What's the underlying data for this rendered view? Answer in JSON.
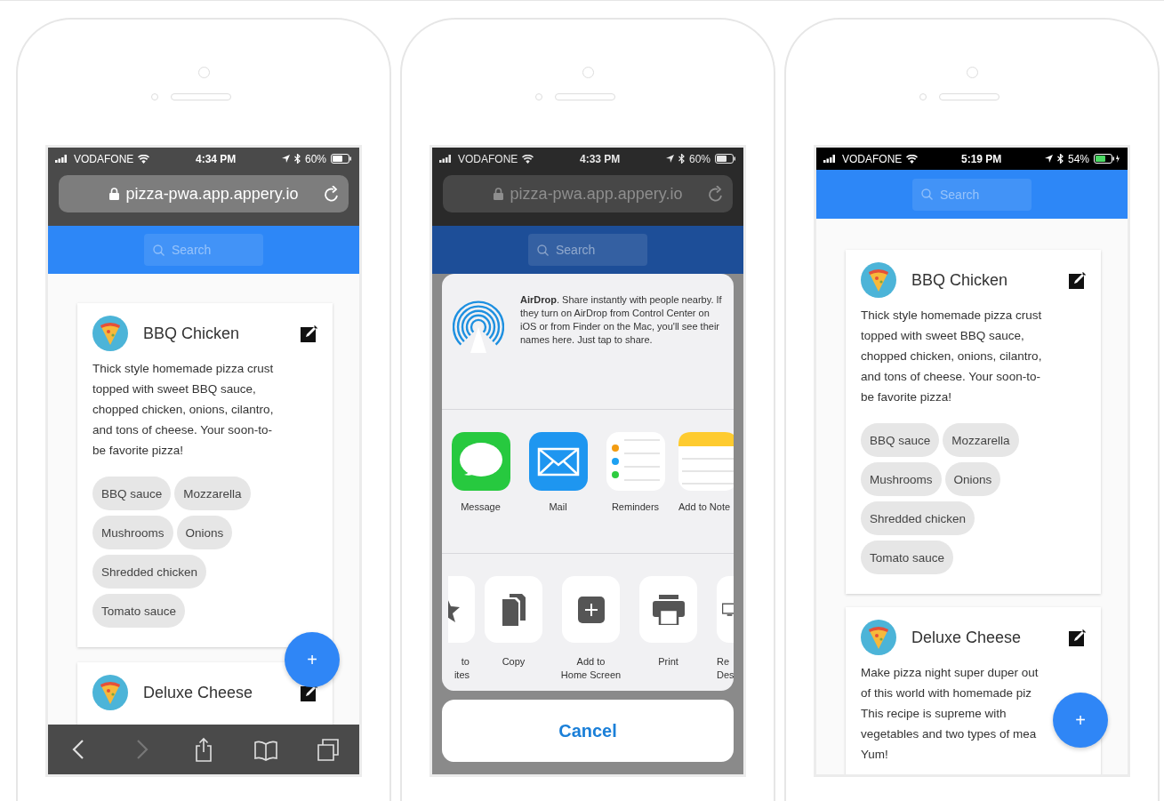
{
  "phones": [
    {
      "kind": "browser",
      "dimmed": false,
      "status": {
        "carrier": "VODAFONE",
        "time": "4:34 PM",
        "battery": "60%",
        "charging": false
      },
      "url": "pizza-pwa.app.appery.io",
      "search": {
        "placeholder": "Search"
      },
      "cards": [
        {
          "title": "BBQ Chicken",
          "description_lines": [
            "Thick style homemade pizza crust",
            "topped with sweet BBQ sauce,",
            "chopped chicken, onions, cilantro,",
            "and tons of cheese. Your soon-to-",
            "be favorite pizza!"
          ],
          "tags": [
            "BBQ sauce",
            "Mozzarella",
            "Mushrooms",
            "Onions",
            "Shredded chicken",
            "Tomato sauce"
          ]
        },
        {
          "title": "Deluxe Cheese"
        }
      ],
      "fab": "+",
      "toolbar": [
        {
          "kind": "back",
          "disabled": false
        },
        {
          "kind": "forward",
          "disabled": true
        },
        {
          "kind": "share",
          "disabled": false
        },
        {
          "kind": "bookmarks",
          "disabled": false
        },
        {
          "kind": "tabs",
          "disabled": false
        }
      ]
    },
    {
      "kind": "share",
      "dimmed": true,
      "status": {
        "carrier": "VODAFONE",
        "time": "4:33 PM",
        "battery": "60%",
        "charging": false
      },
      "url": "pizza-pwa.app.appery.io",
      "search": {
        "placeholder": "Search"
      },
      "share_sheet": {
        "airdrop_text": "**AirDrop**. Share instantly with people nearby. If they turn on AirDrop from Control Center on iOS or from Finder on the Mac, you'll see their names here. Just tap to share.",
        "apps": [
          {
            "kind": "message",
            "label": "Message"
          },
          {
            "kind": "mail",
            "label": "Mail"
          },
          {
            "kind": "reminders",
            "label": "Reminders"
          },
          {
            "kind": "notes",
            "label": "Add to Note"
          }
        ],
        "actions": [
          {
            "kind": "favorites",
            "label": "to\nites"
          },
          {
            "kind": "copy",
            "label": "Copy"
          },
          {
            "kind": "home",
            "label": "Add to\nHome Screen"
          },
          {
            "kind": "print",
            "label": "Print"
          },
          {
            "kind": "desktop",
            "label": "Re\nDes"
          }
        ],
        "cancel": "Cancel"
      }
    },
    {
      "kind": "app",
      "dimmed": false,
      "status": {
        "carrier": "VODAFONE",
        "time": "5:19 PM",
        "battery": "54%",
        "charging": true
      },
      "search": {
        "placeholder": "Search"
      },
      "cards": [
        {
          "title": "BBQ Chicken",
          "description_lines": [
            "Thick style homemade pizza crust",
            "topped with sweet BBQ sauce,",
            "chopped chicken, onions, cilantro,",
            "and tons of cheese. Your soon-to-",
            "be favorite pizza!"
          ],
          "tags": [
            "BBQ sauce",
            "Mozzarella",
            "Mushrooms",
            "Onions",
            "Shredded chicken",
            "Tomato sauce"
          ]
        },
        {
          "title": "Deluxe Cheese",
          "description_lines": [
            "Make pizza night super duper out",
            "of this world with homemade piz",
            "This recipe is supreme with",
            "vegetables and two types of mea",
            "Yum!"
          ]
        }
      ],
      "fab": "+"
    }
  ]
}
